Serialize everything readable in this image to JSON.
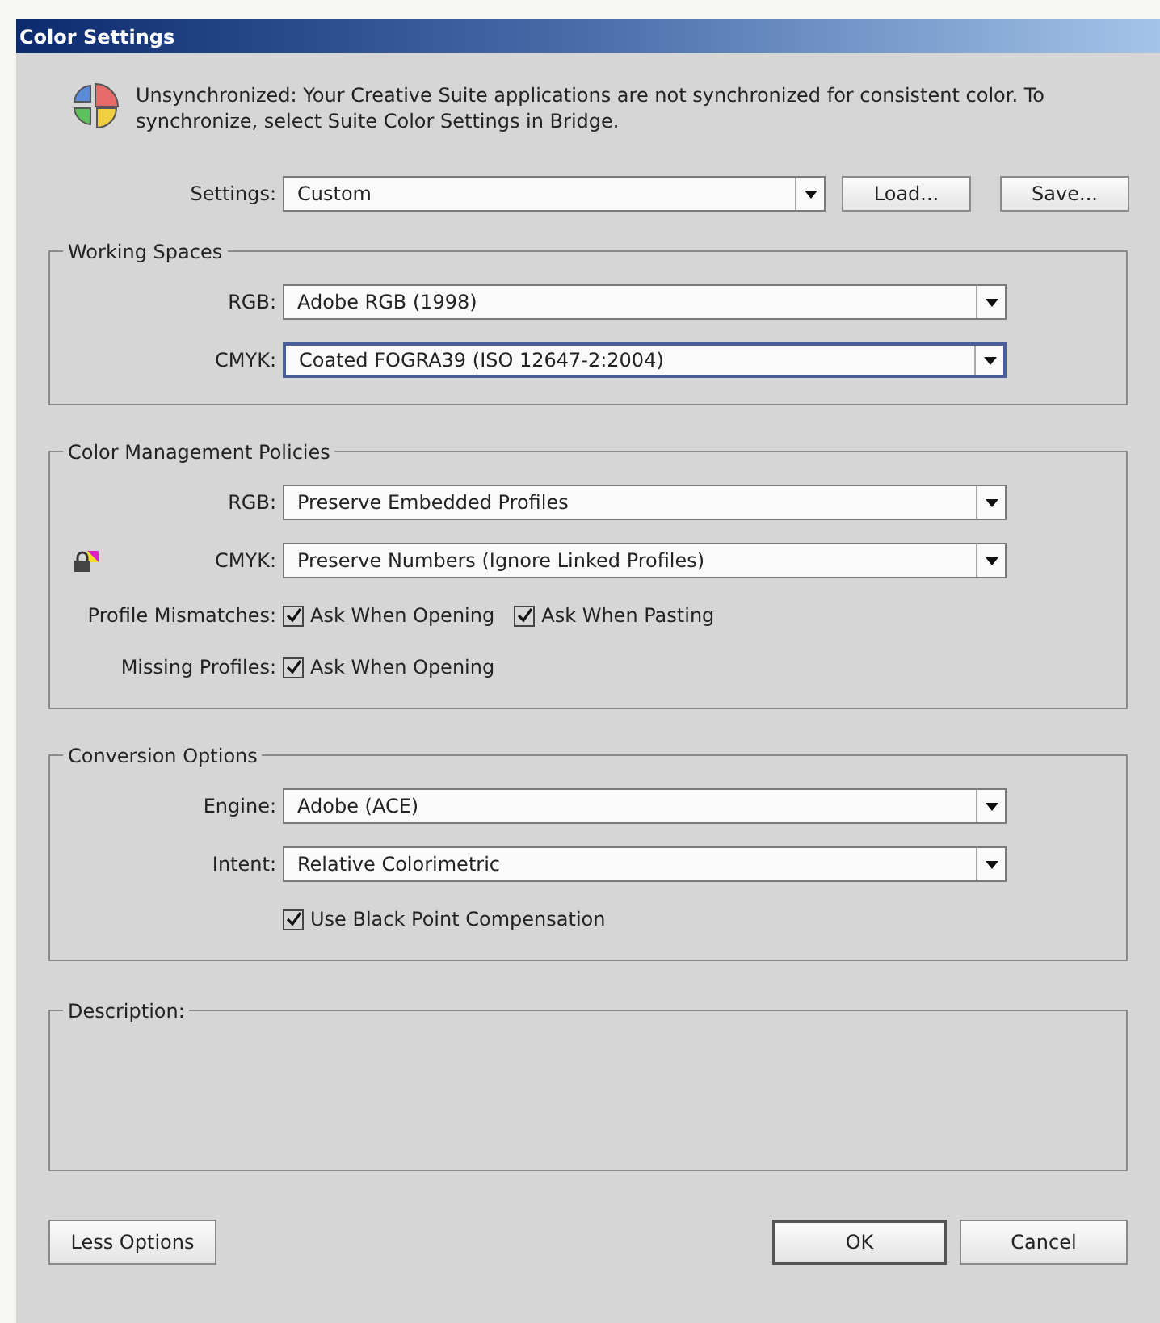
{
  "window": {
    "title": "Color Settings"
  },
  "message": "Unsynchronized: Your Creative Suite applications are not synchronized for consistent color. To synchronize, select Suite Color Settings in Bridge.",
  "settings": {
    "label": "Settings:",
    "value": "Custom",
    "buttons": [
      "Load...",
      "Save..."
    ]
  },
  "sections": [
    {
      "title": "Working Spaces",
      "rows": [
        {
          "kind": "select",
          "label": "RGB:",
          "value": "Adobe RGB (1998)",
          "focused": false,
          "locked": false
        },
        {
          "kind": "select",
          "label": "CMYK:",
          "value": "Coated FOGRA39 (ISO 12647-2:2004)",
          "focused": true,
          "locked": false
        }
      ]
    },
    {
      "title": "Color Management Policies",
      "rows": [
        {
          "kind": "select",
          "label": "RGB:",
          "value": "Preserve Embedded Profiles",
          "focused": false,
          "locked": false
        },
        {
          "kind": "select",
          "label": "CMYK:",
          "value": "Preserve Numbers (Ignore Linked Profiles)",
          "focused": false,
          "locked": true
        },
        {
          "kind": "checks",
          "label": "Profile Mismatches:",
          "checks": [
            {
              "label": "Ask When Opening",
              "checked": true
            },
            {
              "label": "Ask When Pasting",
              "checked": true
            }
          ]
        },
        {
          "kind": "checks",
          "label": "Missing Profiles:",
          "checks": [
            {
              "label": "Ask When Opening",
              "checked": true
            }
          ]
        }
      ]
    },
    {
      "title": "Conversion Options",
      "rows": [
        {
          "kind": "select",
          "label": "Engine:",
          "value": "Adobe (ACE)",
          "focused": false,
          "locked": false
        },
        {
          "kind": "select",
          "label": "Intent:",
          "value": "Relative Colorimetric",
          "focused": false,
          "locked": false
        },
        {
          "kind": "checks",
          "checks": [
            {
              "label": "Use Black Point Compensation",
              "checked": true
            }
          ]
        }
      ]
    }
  ],
  "description": {
    "title": "Description:"
  },
  "buttons": [
    {
      "label": "Less Options",
      "default": false
    },
    {
      "label": "OK",
      "default": true
    },
    {
      "label": "Cancel",
      "default": false
    }
  ]
}
